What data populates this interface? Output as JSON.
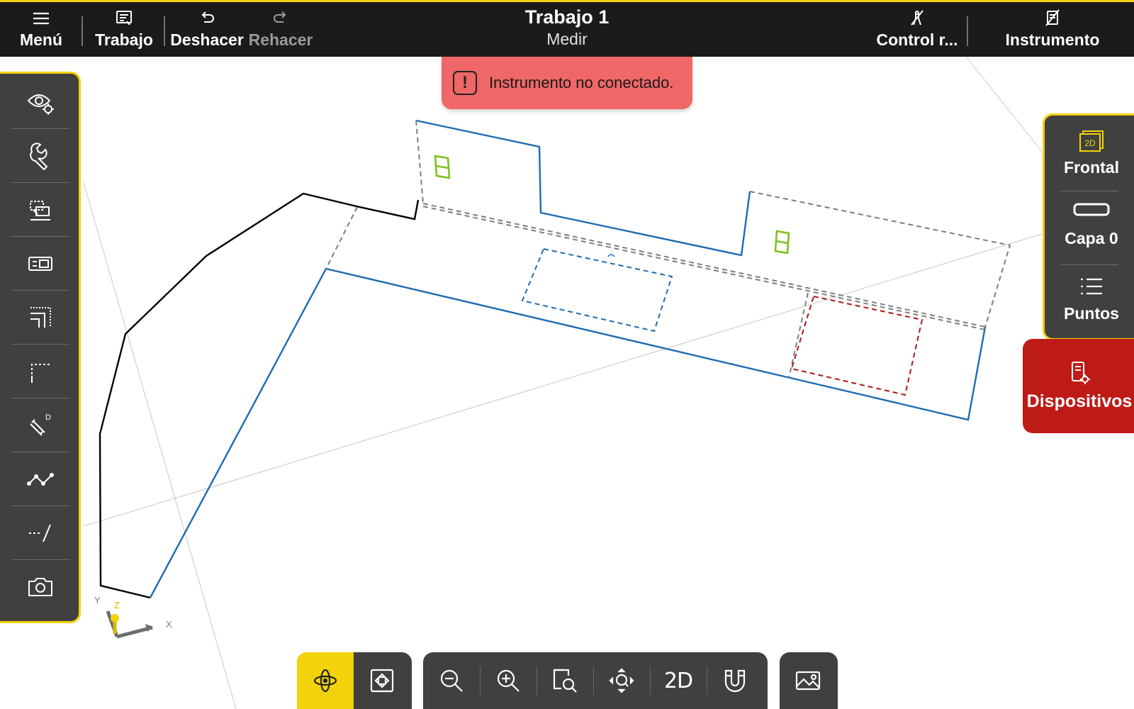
{
  "topbar": {
    "menu_label": "Menú",
    "job_label": "Trabajo",
    "undo_label": "Deshacer",
    "redo_label": "Rehacer",
    "title": "Trabajo 1",
    "subtitle": "Medir",
    "remote_control_label": "Control r...",
    "instrument_label": "Instrumento"
  },
  "toast": {
    "icon": "!",
    "message": "Instrumento no conectado."
  },
  "left_tools": [
    {
      "icon": "view-settings-icon"
    },
    {
      "icon": "wrench-icon"
    },
    {
      "icon": "layers-select-icon"
    },
    {
      "icon": "keyboard-entry-icon"
    },
    {
      "icon": "offset-lines-icon"
    },
    {
      "icon": "corner-icon"
    },
    {
      "icon": "distance-measure-icon"
    },
    {
      "icon": "polyline-icon"
    },
    {
      "icon": "extend-line-icon"
    },
    {
      "icon": "camera-icon"
    }
  ],
  "right_panel": {
    "view_label": "Frontal",
    "view_badge": "2D",
    "layer_label": "Capa 0",
    "points_label": "Puntos",
    "devices_label": "Dispositivos"
  },
  "axes": {
    "x": "X",
    "y": "Y",
    "z": "Z"
  },
  "bottom_toolbar": {
    "two_d_label": "2D"
  },
  "colors": {
    "accent": "#f2d20a",
    "panel": "#404040",
    "topbar": "#1b1b1b",
    "toast": "#ef6767",
    "devices": "#bf1b16",
    "line_blue": "#1f6bb0",
    "line_black": "#000000",
    "line_dashed_grey": "#808080",
    "line_dashed_red": "#b01515",
    "marker_green": "#7cc21b"
  }
}
